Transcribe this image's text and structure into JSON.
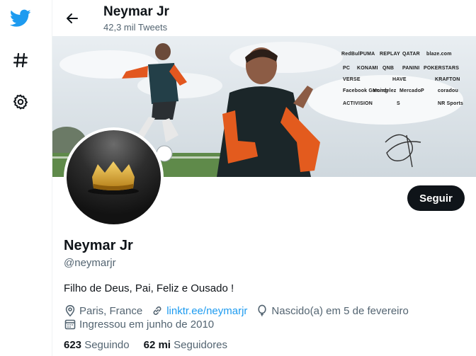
{
  "header": {
    "title": "Neymar Jr",
    "subtitle": "42,3 mil Tweets"
  },
  "nav": {
    "icons": [
      "twitter-bird-icon",
      "hashtag-icon",
      "gear-icon"
    ],
    "accent": "#1d9bf0"
  },
  "banner": {
    "sponsors": [
      "RedBull",
      "PUMA",
      "REPLAY",
      "QATAR",
      "blaze.com",
      "PC",
      "KONAMI",
      "QNB",
      "PANINI",
      "POKERSTARS",
      "VERSE",
      "HAVE",
      "KRAFTON",
      "Facebook Gaming",
      "Mondelez",
      "Mercado",
      "P",
      "coradou",
      "ACTIVISION",
      "S",
      "NR Sports"
    ]
  },
  "profile": {
    "name": "Neymar Jr",
    "handle": "@neymarjr",
    "bio": "Filho de Deus, Pai, Feliz e Ousado !",
    "location": "Paris, France",
    "link": "linktr.ee/neymarjr",
    "birthday": "Nascido(a) em 5 de fevereiro",
    "joined": "Ingressou em junho de 2010",
    "follow_label": "Seguir"
  },
  "stats": {
    "following_count": "623",
    "following_label": "Seguindo",
    "followers_count": "62 mi",
    "followers_label": "Seguidores"
  },
  "colors": {
    "text": "#0f1419",
    "secondary": "#536471",
    "link": "#1d9bf0",
    "button": "#0f1419"
  }
}
